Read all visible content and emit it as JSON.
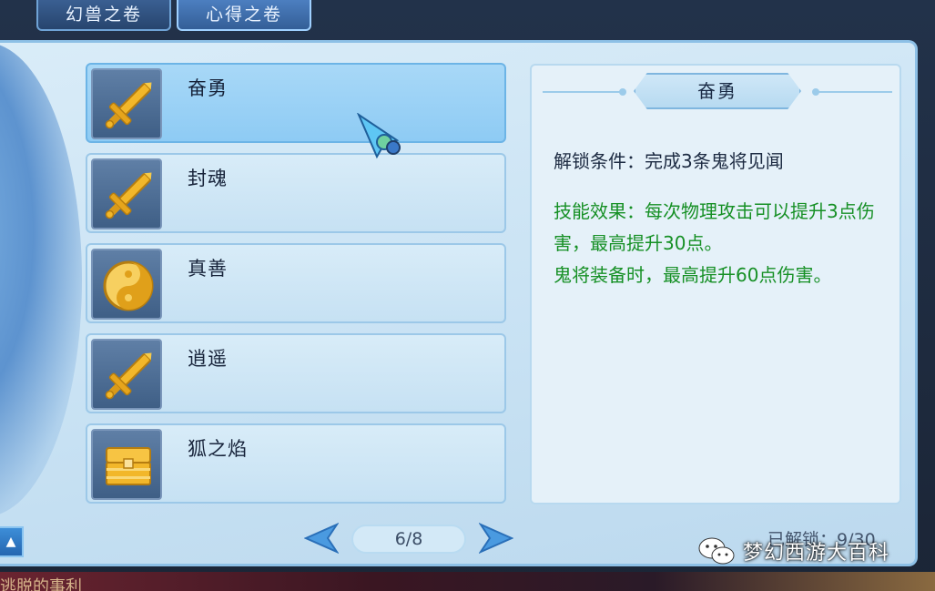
{
  "tabs": [
    {
      "label": "幻兽之卷",
      "active": false
    },
    {
      "label": "心得之卷",
      "active": true
    }
  ],
  "skills": [
    {
      "name": "奋勇",
      "icon": "sword-icon",
      "selected": true
    },
    {
      "name": "封魂",
      "icon": "sword-icon",
      "selected": false
    },
    {
      "name": "真善",
      "icon": "yin-yang-icon",
      "selected": false
    },
    {
      "name": "逍遥",
      "icon": "sword-icon",
      "selected": false
    },
    {
      "name": "狐之焰",
      "icon": "treasure-chest-icon",
      "selected": false
    }
  ],
  "detail": {
    "title": "奋勇",
    "unlock_condition": "解锁条件：完成3条鬼将见闻",
    "effect_line1": "技能效果：每次物理攻击可以提升3点伤害，最高提升30点。",
    "effect_line2": "鬼将装备时，最高提升60点伤害。"
  },
  "pager": {
    "page": "6/8"
  },
  "unlocked_count": "已解锁：9/30",
  "watermark": "梦幻西游大百科",
  "bottom_text": "逃脱的事利",
  "colors": {
    "effect_text": "#169025",
    "selected_item": "#8ecbf4",
    "icon_gold": "#f2b72a"
  }
}
